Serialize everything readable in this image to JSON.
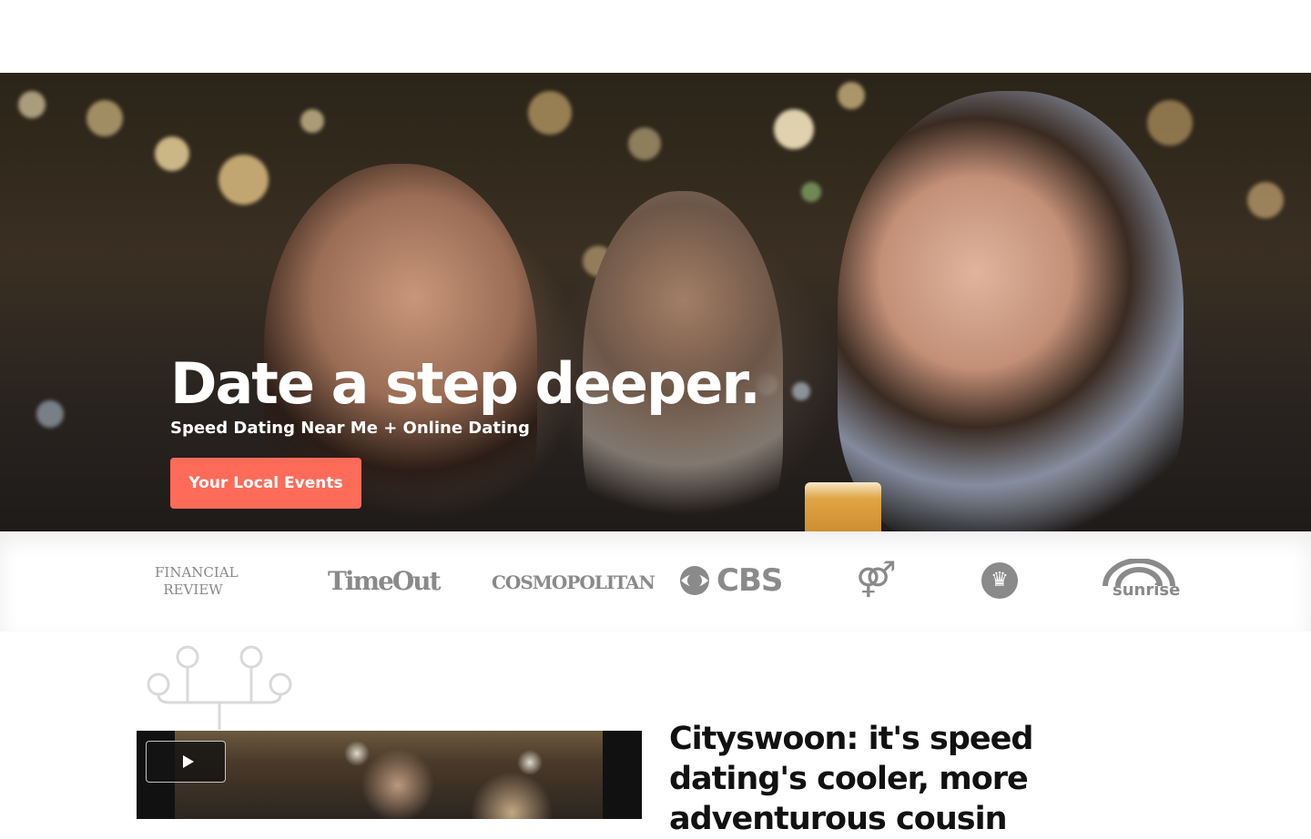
{
  "hero": {
    "title": "Date a step deeper.",
    "subtitle": "Speed Dating Near Me + Online Dating",
    "cta_label": "Your Local Events",
    "cta_color": "#fe6b59"
  },
  "press_logos": [
    {
      "name": "financial-review",
      "line1": "FINANCIAL",
      "line2": "REVIEW"
    },
    {
      "name": "time-out",
      "text": "TimeOut"
    },
    {
      "name": "cosmopolitan",
      "text": "COSMOPOLITAN"
    },
    {
      "name": "cbs",
      "text": "CBS",
      "icon": "cbs-eye-icon"
    },
    {
      "name": "gender-symbols",
      "icon": "gender-symbols-icon"
    },
    {
      "name": "guinness-world-records",
      "icon": "guinness-seal-icon"
    },
    {
      "name": "sunrise",
      "text": "sunrise",
      "icon": "sunrise-arc-icon"
    }
  ],
  "intro": {
    "heading": "Cityswoon: it's speed dating's cooler, more adventurous cousin"
  },
  "video": {
    "play_icon": "play-icon"
  },
  "colors": {
    "accent": "#fe6b59",
    "logo_gray": "#8a8a8a"
  }
}
